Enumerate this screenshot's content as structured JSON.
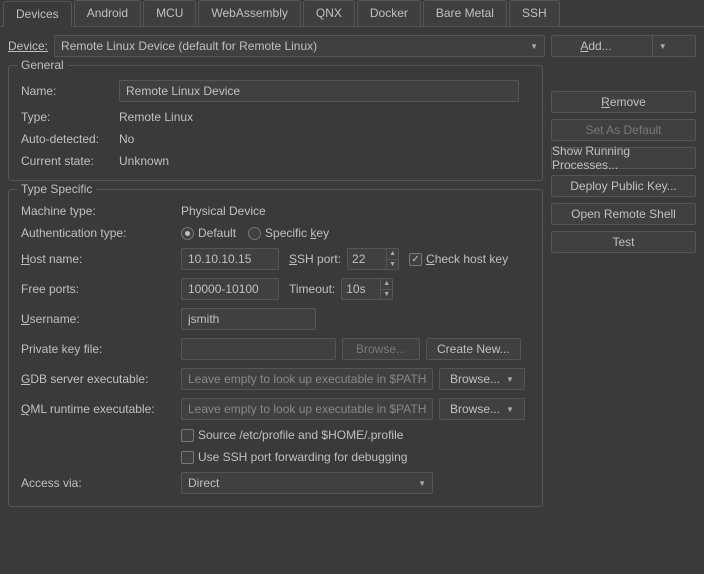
{
  "tabs": [
    "Devices",
    "Android",
    "MCU",
    "WebAssembly",
    "QNX",
    "Docker",
    "Bare Metal",
    "SSH"
  ],
  "device_row": {
    "label_pre": "D",
    "label_post": "evice:",
    "selected": "Remote Linux Device (default for Remote Linux)",
    "add_pre": "A",
    "add_post": "dd..."
  },
  "side": {
    "remove_pre": "R",
    "remove_post": "emove",
    "set_default": "Set As Default",
    "show_proc": "Show Running Processes...",
    "deploy": "Deploy Public Key...",
    "shell": "Open Remote Shell",
    "test": "Test"
  },
  "general": {
    "title": "General",
    "name_lbl": "Name:",
    "name_val": "Remote Linux Device",
    "type_lbl": "Type:",
    "type_val": "Remote Linux",
    "auto_lbl": "Auto-detected:",
    "auto_val": "No",
    "state_lbl": "Current state:",
    "state_val": "Unknown"
  },
  "ts": {
    "title": "Type Specific",
    "machine_lbl": "Machine type:",
    "machine_val": "Physical Device",
    "auth_lbl": "Authentication type:",
    "auth_default": "Default",
    "auth_specific_pre": "Specific ",
    "auth_specific_u": "k",
    "auth_specific_post": "ey",
    "host_lbl_pre": "H",
    "host_lbl_post": "ost name:",
    "host_val": "10.10.10.15",
    "sshport_lbl_pre": "S",
    "sshport_lbl_post": "SH port:",
    "sshport_val": "22",
    "checkhost_pre": "C",
    "checkhost_post": "heck host key",
    "free_lbl": "Free ports:",
    "free_val": "10000-10100",
    "timeout_lbl": "Timeout:",
    "timeout_val": "10s",
    "user_lbl_pre": "U",
    "user_lbl_post": "sername:",
    "user_val": "jsmith",
    "pk_lbl": "Private key file:",
    "browse": "Browse...",
    "create_new": "Create New...",
    "gdb_lbl_pre": "G",
    "gdb_lbl_post": "DB server executable:",
    "placeholder": "Leave empty to look up executable in $PATH",
    "qml_lbl_pre": "Q",
    "qml_lbl_post": "ML runtime executable:",
    "src_profile": "Source /etc/profile and $HOME/.profile",
    "ssh_fwd": "Use SSH port forwarding for debugging",
    "access_lbl": "Access via:",
    "access_val": "Direct"
  }
}
